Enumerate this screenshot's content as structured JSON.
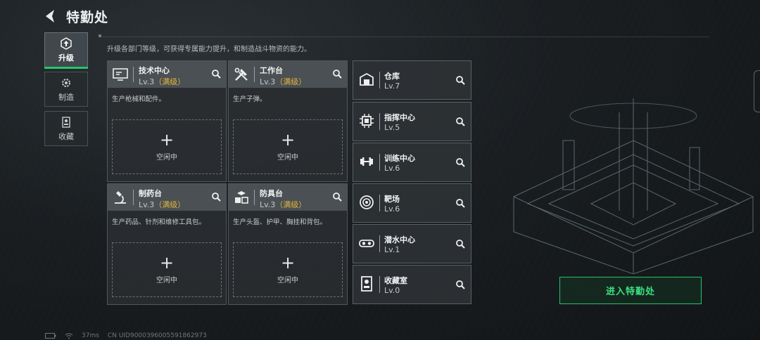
{
  "header": {
    "title": "特勤处"
  },
  "tabs": [
    {
      "label": "升级",
      "icon": "upgrade-icon",
      "active": true
    },
    {
      "label": "制造",
      "icon": "gear-icon",
      "active": false
    },
    {
      "label": "收藏",
      "icon": "trophy-icon",
      "active": false
    }
  ],
  "description": "升级各部门等级，可获得专属能力提升，和制造战斗物资的能力。",
  "cards": [
    {
      "name": "技术中心",
      "level": "Lv.3",
      "max_label": "（满级）",
      "desc": "生产枪械和配件。",
      "slot_status": "空闲中",
      "icon": "monitor-icon"
    },
    {
      "name": "工作台",
      "level": "Lv.3",
      "max_label": "（满级）",
      "desc": "生产子弹。",
      "slot_status": "空闲中",
      "icon": "tools-icon"
    },
    {
      "name": "制药台",
      "level": "Lv.3",
      "max_label": "（满级）",
      "desc": "生产药品、针剂和维修工具包。",
      "slot_status": "空闲中",
      "icon": "microscope-icon"
    },
    {
      "name": "防具台",
      "level": "Lv.3",
      "max_label": "（满级）",
      "desc": "生产头盔、护甲、胸挂和背包。",
      "slot_status": "空闲中",
      "icon": "boxes-icon"
    }
  ],
  "facilities": [
    {
      "name": "仓库",
      "level": "Lv.7",
      "icon": "warehouse-icon"
    },
    {
      "name": "指挥中心",
      "level": "Lv.5",
      "icon": "chip-icon"
    },
    {
      "name": "训练中心",
      "level": "Lv.6",
      "icon": "dumbbell-icon"
    },
    {
      "name": "靶场",
      "level": "Lv.6",
      "icon": "target-icon"
    },
    {
      "name": "潜水中心",
      "level": "Lv.1",
      "icon": "goggles-icon"
    },
    {
      "name": "收藏室",
      "level": "Lv.0",
      "icon": "display-case-icon"
    }
  ],
  "enter_button": "进入特勤处",
  "footer": {
    "ping": "37ms",
    "uid": "CN UID9000396005591862973"
  },
  "colors": {
    "accent": "#27c46b",
    "max_level": "#e1b43c"
  }
}
